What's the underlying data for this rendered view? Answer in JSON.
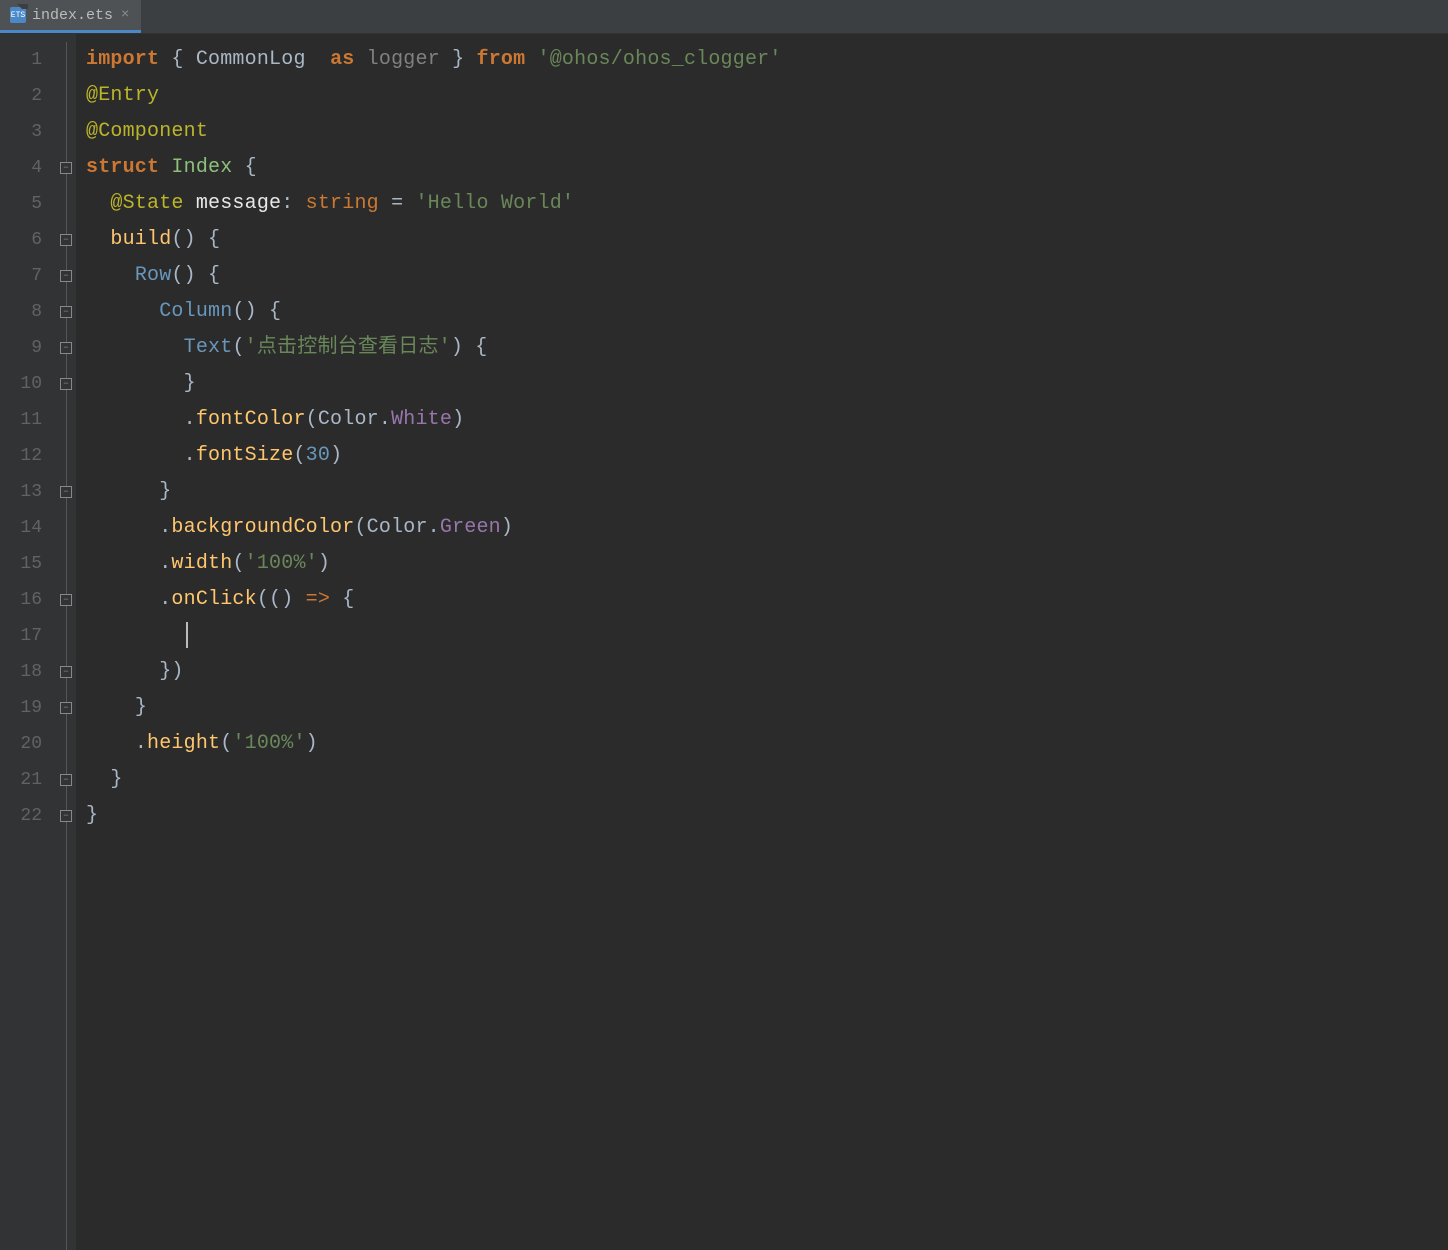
{
  "tab": {
    "filename": "index.ets",
    "icon_text": "ETS"
  },
  "gutter": {
    "line_count": 22
  },
  "code": {
    "lines": [
      {
        "t": [
          {
            "c": "kw",
            "v": "import "
          },
          {
            "c": "brace",
            "v": "{ "
          },
          {
            "c": "import-name",
            "v": "CommonLog  "
          },
          {
            "c": "as-kw",
            "v": "as "
          },
          {
            "c": "alias",
            "v": "logger "
          },
          {
            "c": "brace",
            "v": "} "
          },
          {
            "c": "from-kw",
            "v": "from "
          },
          {
            "c": "string-green",
            "v": "'@ohos/ohos_clogger'"
          }
        ]
      },
      {
        "t": [
          {
            "c": "decorator",
            "v": "@Entry"
          }
        ]
      },
      {
        "t": [
          {
            "c": "decorator",
            "v": "@Component"
          }
        ]
      },
      {
        "t": [
          {
            "c": "kw",
            "v": "struct "
          },
          {
            "c": "struct-name",
            "v": "Index "
          },
          {
            "c": "brace",
            "v": "{"
          }
        ]
      },
      {
        "t": [
          {
            "c": "white-text",
            "v": "  "
          },
          {
            "c": "decorator",
            "v": "@State "
          },
          {
            "c": "white-text",
            "v": "message"
          },
          {
            "c": "punct",
            "v": ": "
          },
          {
            "c": "kw2",
            "v": "string "
          },
          {
            "c": "punct",
            "v": "= "
          },
          {
            "c": "string-green",
            "v": "'Hello World'"
          }
        ]
      },
      {
        "t": [
          {
            "c": "white-text",
            "v": "  "
          },
          {
            "c": "func-name",
            "v": "build"
          },
          {
            "c": "paren",
            "v": "() "
          },
          {
            "c": "brace",
            "v": "{"
          }
        ]
      },
      {
        "t": [
          {
            "c": "white-text",
            "v": "    "
          },
          {
            "c": "func-call",
            "v": "Row"
          },
          {
            "c": "paren",
            "v": "() "
          },
          {
            "c": "brace",
            "v": "{"
          }
        ]
      },
      {
        "t": [
          {
            "c": "white-text",
            "v": "      "
          },
          {
            "c": "func-call",
            "v": "Column"
          },
          {
            "c": "paren",
            "v": "() "
          },
          {
            "c": "brace",
            "v": "{"
          }
        ]
      },
      {
        "t": [
          {
            "c": "white-text",
            "v": "        "
          },
          {
            "c": "func-call",
            "v": "Text"
          },
          {
            "c": "paren",
            "v": "("
          },
          {
            "c": "string-green",
            "v": "'点击控制台查看日志'"
          },
          {
            "c": "paren",
            "v": ") "
          },
          {
            "c": "brace",
            "v": "{"
          }
        ]
      },
      {
        "t": [
          {
            "c": "white-text",
            "v": "        "
          },
          {
            "c": "brace",
            "v": "}"
          }
        ]
      },
      {
        "t": [
          {
            "c": "white-text",
            "v": "        "
          },
          {
            "c": "dot",
            "v": "."
          },
          {
            "c": "func-name",
            "v": "fontColor"
          },
          {
            "c": "paren",
            "v": "("
          },
          {
            "c": "text-label",
            "v": "Color"
          },
          {
            "c": "dot",
            "v": "."
          },
          {
            "c": "prop",
            "v": "White"
          },
          {
            "c": "paren",
            "v": ")"
          }
        ]
      },
      {
        "t": [
          {
            "c": "white-text",
            "v": "        "
          },
          {
            "c": "dot",
            "v": "."
          },
          {
            "c": "func-name",
            "v": "fontSize"
          },
          {
            "c": "paren",
            "v": "("
          },
          {
            "c": "number",
            "v": "30"
          },
          {
            "c": "paren",
            "v": ")"
          }
        ]
      },
      {
        "t": [
          {
            "c": "white-text",
            "v": "      "
          },
          {
            "c": "brace",
            "v": "}"
          }
        ]
      },
      {
        "t": [
          {
            "c": "white-text",
            "v": "      "
          },
          {
            "c": "dot",
            "v": "."
          },
          {
            "c": "func-name",
            "v": "backgroundColor"
          },
          {
            "c": "paren",
            "v": "("
          },
          {
            "c": "text-label",
            "v": "Color"
          },
          {
            "c": "dot",
            "v": "."
          },
          {
            "c": "prop",
            "v": "Green"
          },
          {
            "c": "paren",
            "v": ")"
          }
        ]
      },
      {
        "t": [
          {
            "c": "white-text",
            "v": "      "
          },
          {
            "c": "dot",
            "v": "."
          },
          {
            "c": "func-name",
            "v": "width"
          },
          {
            "c": "paren",
            "v": "("
          },
          {
            "c": "string-green",
            "v": "'100%'"
          },
          {
            "c": "paren",
            "v": ")"
          }
        ]
      },
      {
        "t": [
          {
            "c": "white-text",
            "v": "      "
          },
          {
            "c": "dot",
            "v": "."
          },
          {
            "c": "func-name",
            "v": "onClick"
          },
          {
            "c": "paren",
            "v": "(() "
          },
          {
            "c": "arrow",
            "v": "=> "
          },
          {
            "c": "brace",
            "v": "{"
          }
        ]
      },
      {
        "t": [
          {
            "c": "white-text",
            "v": "        "
          },
          {
            "cursor": true
          }
        ]
      },
      {
        "t": [
          {
            "c": "white-text",
            "v": "      "
          },
          {
            "c": "brace",
            "v": "})"
          }
        ]
      },
      {
        "t": [
          {
            "c": "white-text",
            "v": "    "
          },
          {
            "c": "brace",
            "v": "}"
          }
        ]
      },
      {
        "t": [
          {
            "c": "white-text",
            "v": "    "
          },
          {
            "c": "dot",
            "v": "."
          },
          {
            "c": "func-name",
            "v": "height"
          },
          {
            "c": "paren",
            "v": "("
          },
          {
            "c": "string-green",
            "v": "'100%'"
          },
          {
            "c": "paren",
            "v": ")"
          }
        ]
      },
      {
        "t": [
          {
            "c": "white-text",
            "v": "  "
          },
          {
            "c": "brace",
            "v": "}"
          }
        ]
      },
      {
        "t": [
          {
            "c": "brace",
            "v": "}"
          }
        ]
      }
    ]
  },
  "fold": {
    "markers": [
      {
        "line": 4,
        "type": "open"
      },
      {
        "line": 6,
        "type": "open"
      },
      {
        "line": 7,
        "type": "open"
      },
      {
        "line": 8,
        "type": "open"
      },
      {
        "line": 9,
        "type": "open"
      },
      {
        "line": 10,
        "type": "close"
      },
      {
        "line": 13,
        "type": "close"
      },
      {
        "line": 16,
        "type": "open"
      },
      {
        "line": 18,
        "type": "close"
      },
      {
        "line": 19,
        "type": "close"
      },
      {
        "line": 21,
        "type": "close"
      },
      {
        "line": 22,
        "type": "close"
      }
    ]
  }
}
